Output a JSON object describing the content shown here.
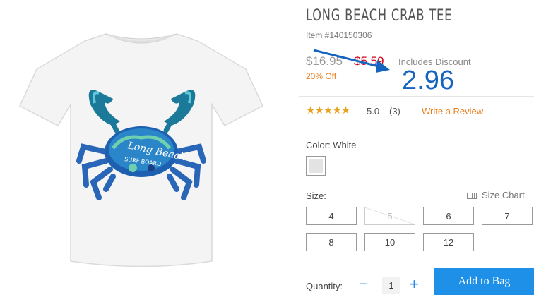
{
  "product": {
    "title": "LONG BEACH CRAB TEE",
    "item_number": "Item #140150306",
    "old_price": "$16.95",
    "new_price": "$5.59",
    "includes_discount": "Includes Discount",
    "percent_off": "20% Off",
    "shirt_text_line1": "Long Beach",
    "shirt_text_line2": "SURF BOARD"
  },
  "annotation": {
    "value": "2.96",
    "color": "#1565c0"
  },
  "rating": {
    "stars": "★★★★★",
    "score": "5.0",
    "count": "(3)",
    "write_review": "Write a Review",
    "star_color": "#e8a21f"
  },
  "color": {
    "label": "Color: White",
    "swatch_name": "White"
  },
  "size": {
    "label": "Size:",
    "chart_label": "Size Chart",
    "options": [
      "4",
      "5",
      "6",
      "7",
      "8",
      "10",
      "12"
    ],
    "unavailable": [
      "5"
    ]
  },
  "quantity": {
    "label": "Quantity:",
    "minus": "−",
    "value": "1",
    "plus": "+"
  },
  "cart": {
    "add_label": "Add to Bag",
    "button_color": "#1e90e8"
  },
  "colors": {
    "accent_orange": "#e8811f",
    "price_red": "#d0021b"
  }
}
